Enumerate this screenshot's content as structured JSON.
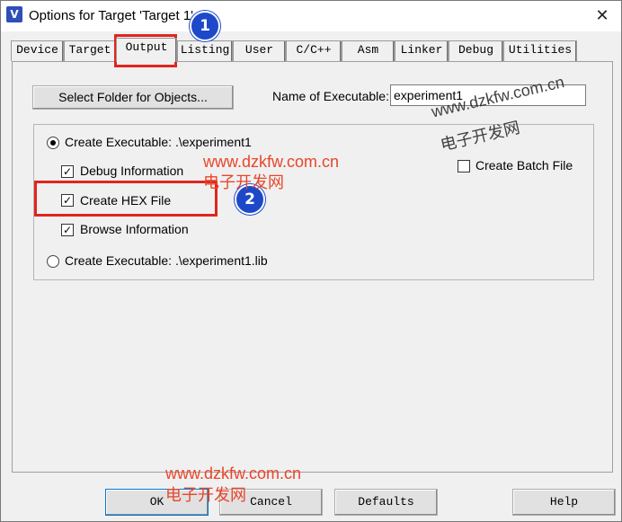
{
  "window": {
    "title": "Options for Target 'Target 1'",
    "close_glyph": "✕",
    "icon": "keil-uv-icon",
    "icon_glyph": "V"
  },
  "tabs": [
    {
      "label": "Device"
    },
    {
      "label": "Target"
    },
    {
      "label": "Output",
      "active": true
    },
    {
      "label": "Listing"
    },
    {
      "label": "User"
    },
    {
      "label": "C/C++"
    },
    {
      "label": "Asm"
    },
    {
      "label": "Linker"
    },
    {
      "label": "Debug"
    },
    {
      "label": "Utilities"
    }
  ],
  "output": {
    "select_folder_label": "Select Folder for Objects...",
    "name_label": "Name of Executable:",
    "name_value": "experiment1",
    "create_executable_label": "Create Executable:  .\\experiment1",
    "debug_info_label": "Debug Information",
    "create_hex_label": "Create HEX File",
    "browse_info_label": "Browse Information",
    "create_library_label": "Create Executable:  .\\experiment1.lib",
    "create_batch_label": "Create Batch File",
    "check_glyph": "✓"
  },
  "footer": {
    "ok_label": "OK",
    "cancel_label": "Cancel",
    "defaults_label": "Defaults",
    "help_label": "Help"
  },
  "annotations": {
    "step1": "1",
    "step2": "2",
    "highlight_color": "#e0251e",
    "badge_color": "#1d49c9"
  },
  "watermarks": {
    "url": "www.dzkfw.com.cn",
    "name": "电子开发网"
  }
}
